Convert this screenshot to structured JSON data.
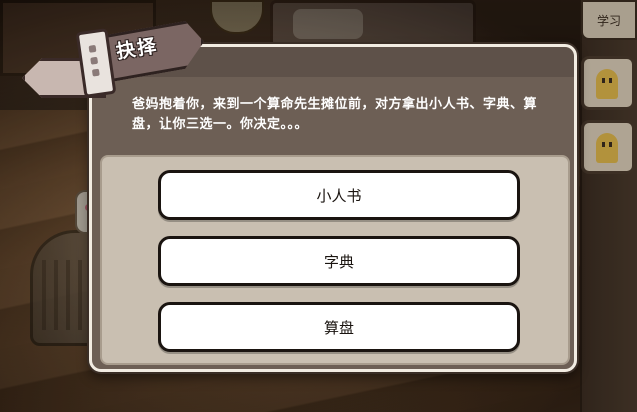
{
  "dialog": {
    "title": "抉择",
    "prompt": "爸妈抱着你，来到一个算命先生摊位前，对方拿出小人书、字典、算盘，让你三选一。你决定。。。",
    "choices": [
      {
        "label": "小人书"
      },
      {
        "label": "字典"
      },
      {
        "label": "算盘"
      }
    ]
  },
  "sidebar": {
    "tab_label": "学习"
  },
  "colors": {
    "dialog_bg": "#6d5f55",
    "choices_panel": "#c9bfb1",
    "choice_button": "#ffffff",
    "ribbon": "#7b6663"
  }
}
